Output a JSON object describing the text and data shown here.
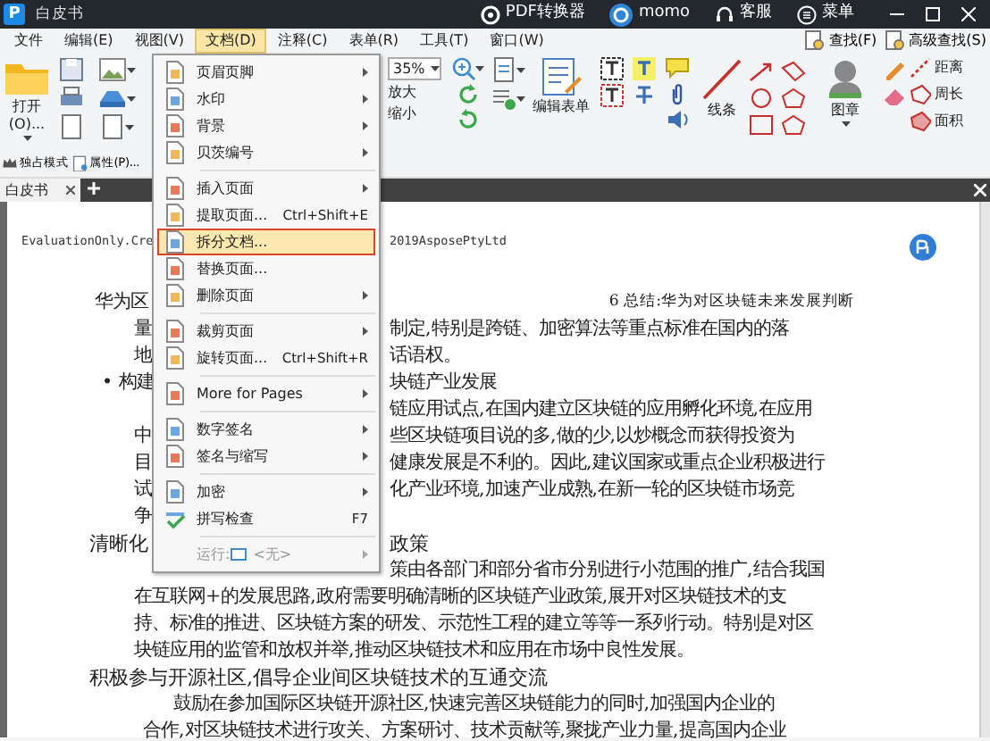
{
  "window": {
    "logo": "P",
    "title": "白皮书"
  },
  "title_bar": {
    "items": [
      {
        "kind": "converter",
        "label": "PDF转换器"
      },
      {
        "kind": "user",
        "label": "momo"
      },
      {
        "kind": "support",
        "label": "客服"
      },
      {
        "kind": "menu",
        "label": "菜单"
      }
    ]
  },
  "menu_bar": {
    "items": [
      {
        "label": "文件",
        "selected": false
      },
      {
        "label": "编辑(E)",
        "selected": false
      },
      {
        "label": "视图(V)",
        "selected": false
      },
      {
        "label": "文档(D)",
        "selected": true
      },
      {
        "label": "注释(C)",
        "selected": false
      },
      {
        "label": "表单(R)",
        "selected": false
      },
      {
        "label": "工具(T)",
        "selected": false
      },
      {
        "label": "窗口(W)",
        "selected": false
      }
    ],
    "search": [
      {
        "label": "查找(F)"
      },
      {
        "label": "高级查找(S)"
      }
    ]
  },
  "ribbon": {
    "open_label": "打开(O)...",
    "zoom_value": "35%",
    "zoom_in": "放大",
    "zoom_out": "缩小",
    "edit_form": "编辑表单",
    "lines": "线条",
    "stamp": "图章",
    "measure": [
      "距离",
      "周长",
      "面积"
    ]
  },
  "toolbar_row": [
    {
      "kind": "crown",
      "label": "独占模式"
    },
    {
      "kind": "properties",
      "label": "属性(P)..."
    }
  ],
  "tabs": [
    {
      "label": "白皮书",
      "selected": true
    }
  ],
  "document_menu": {
    "items": [
      {
        "kind": "page",
        "label": "页眉页脚",
        "submenu": true,
        "selected": false,
        "disabled": false
      },
      {
        "kind": "page",
        "label": "水印",
        "submenu": true,
        "selected": false,
        "disabled": false
      },
      {
        "kind": "page",
        "label": "背景",
        "submenu": true,
        "selected": false,
        "disabled": false
      },
      {
        "kind": "page",
        "label": "贝茨编号",
        "submenu": true,
        "selected": false,
        "disabled": false
      },
      {
        "kind": "separator"
      },
      {
        "kind": "page",
        "label": "插入页面",
        "submenu": true,
        "selected": false,
        "disabled": false
      },
      {
        "kind": "page",
        "label": "提取页面...",
        "shortcut": "Ctrl+Shift+E",
        "submenu": false,
        "selected": false,
        "disabled": false
      },
      {
        "kind": "page",
        "label": "拆分文档...",
        "submenu": false,
        "selected": true,
        "disabled": false
      },
      {
        "kind": "page",
        "label": "替换页面...",
        "submenu": false,
        "selected": false,
        "disabled": false
      },
      {
        "kind": "page",
        "label": "删除页面",
        "submenu": true,
        "selected": false,
        "disabled": false
      },
      {
        "kind": "separator"
      },
      {
        "kind": "page",
        "label": "裁剪页面",
        "submenu": true,
        "selected": false,
        "disabled": false
      },
      {
        "kind": "page",
        "label": "旋转页面...",
        "shortcut": "Ctrl+Shift+R",
        "submenu": false,
        "selected": false,
        "disabled": false
      },
      {
        "kind": "separator"
      },
      {
        "kind": "page",
        "label": "More for Pages",
        "submenu": true,
        "selected": false,
        "disabled": false
      },
      {
        "kind": "separator"
      },
      {
        "kind": "page",
        "label": "数字签名",
        "submenu": true,
        "selected": false,
        "disabled": false
      },
      {
        "kind": "page",
        "label": "签名与缩写",
        "submenu": true,
        "selected": false,
        "disabled": false
      },
      {
        "kind": "separator"
      },
      {
        "kind": "page",
        "label": "加密",
        "submenu": true,
        "selected": false,
        "disabled": false
      },
      {
        "kind": "spellcheck",
        "label": "拼写检查",
        "shortcut": "F7",
        "submenu": false,
        "selected": false,
        "disabled": false
      },
      {
        "kind": "separator"
      },
      {
        "kind": "run",
        "label": "运行:",
        "value": "<无>",
        "submenu": true,
        "selected": false,
        "disabled": true
      }
    ]
  },
  "document": {
    "lines": [
      {
        "kind": "mono",
        "left": "EvaluationOnly.Cre",
        "right": "2019AsposePtyLtd"
      },
      {
        "kind": "header",
        "left": "华为区",
        "right": "6 总结:华为对区块链未来发展判断"
      },
      {
        "kind": "body",
        "left": "量",
        "right": "制定,特别是跨链、加密算法等重点标准在国内的落"
      },
      {
        "kind": "body",
        "left": "地",
        "right": "话语权。"
      },
      {
        "kind": "bullet",
        "left": "• 构建",
        "right": "块链产业发展"
      },
      {
        "kind": "body",
        "right": "链应用试点,在国内建立区块链的应用孵化环境,在应用"
      },
      {
        "kind": "body",
        "left": "中",
        "right": "些区块链项目说的多,做的少,以炒概念而获得投资为"
      },
      {
        "kind": "body",
        "left": "目",
        "right": "健康发展是不利的。因此,建议国家或重点企业积极进行"
      },
      {
        "kind": "body",
        "left": "试",
        "right": "化产业环境,加速产业成熟,在新一轮的区块链市场竞"
      },
      {
        "kind": "body",
        "left": "争"
      },
      {
        "kind": "heading",
        "left": "清晰化",
        "right": "政策"
      },
      {
        "kind": "body",
        "right": "策由各部门和部分省市分别进行小范围的推广,结合我国"
      },
      {
        "kind": "body",
        "left": "在互联网+的发展思路,政府需要明确清晰的区块链产业政策,展开对区块链技术的支"
      },
      {
        "kind": "body",
        "left": "持、标准的推进、区块链方案的研发、示范性工程的建立等等一系列行动。特别是对区"
      },
      {
        "kind": "body",
        "left": "块链应用的监管和放权并举,推动区块链技术和应用在市场中良性发展。"
      },
      {
        "kind": "heading",
        "left": "积极参与开源社区,倡导企业间区块链技术的互通交流"
      },
      {
        "kind": "first",
        "left": "鼓励在参加国际区块链开源社区,快速完善区块链能力的同时,加强国内企业的"
      },
      {
        "kind": "cont",
        "left": "合作,对区块链技术进行攻关、方案研讨、技术贡献等,聚拢产业力量,提高国内企业"
      }
    ]
  }
}
